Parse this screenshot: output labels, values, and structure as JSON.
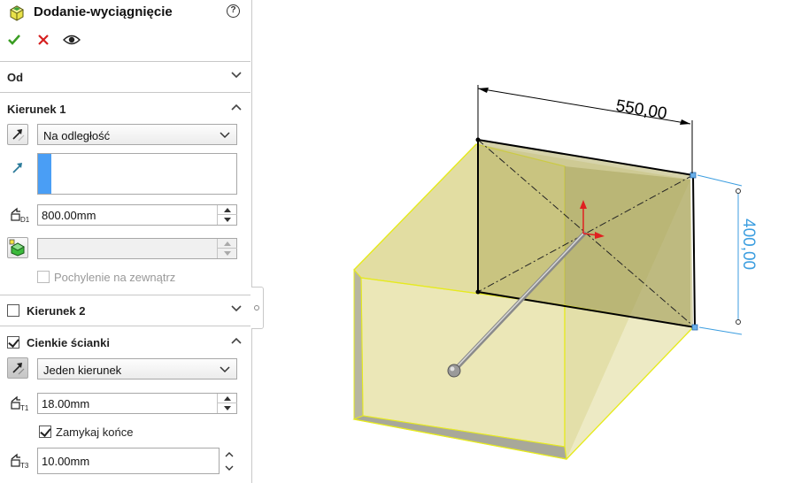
{
  "panel": {
    "title": "Dodanie-wyciągnięcie",
    "help_icon": "help-icon",
    "actions": {
      "ok_icon": "checkmark-icon",
      "cancel_icon": "close-icon",
      "preview_icon": "eye-icon"
    }
  },
  "sections": {
    "from": {
      "label": "Od",
      "expanded": false
    },
    "direction1": {
      "label": "Kierunek 1",
      "expanded": true,
      "end_condition": "Na odległość",
      "depth_value": "800.00mm",
      "draft_value": "",
      "draft_outward_label": "Pochylenie na zewnątrz",
      "draft_outward_checked": false
    },
    "direction2": {
      "label": "Kierunek 2",
      "checked": false,
      "expanded": false
    },
    "thin_feature": {
      "label": "Cienkie ścianki",
      "checked": true,
      "expanded": true,
      "type": "Jeden kierunek",
      "thickness_value": "18.00mm",
      "cap_ends_label": "Zamykaj końce",
      "cap_ends_checked": true,
      "cap_thickness_value": "10.00mm"
    }
  },
  "viewport": {
    "dim_width": "550,00",
    "dim_height": "400,00",
    "colors": {
      "body_fill": "#c8c06a",
      "body_edge": "#e6ea1e",
      "sketch": "#000000",
      "dim_blue": "#3c9ee0",
      "triad_red": "#e02020"
    }
  }
}
